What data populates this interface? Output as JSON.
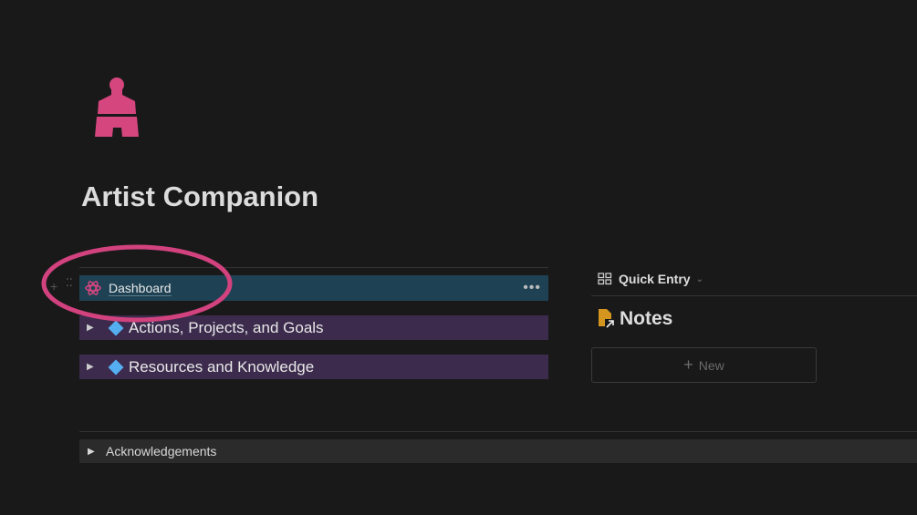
{
  "page": {
    "title": "Artist Companion",
    "icon": "paintbrush-icon",
    "icon_color": "#d5467f"
  },
  "toggles": [
    {
      "label": "Dashboard",
      "icon": "atom-icon",
      "more": "•••"
    },
    {
      "label": "Actions, Projects, and Goals",
      "icon": "diamond-icon"
    },
    {
      "label": "Resources and Knowledge",
      "icon": "diamond-icon"
    }
  ],
  "right": {
    "view_label": "Quick Entry",
    "db_title": "Notes",
    "new_label": "New",
    "new_icon": "+"
  },
  "footer": {
    "toggle_label": "Acknowledgements"
  },
  "annotation_color": "#d1427e"
}
